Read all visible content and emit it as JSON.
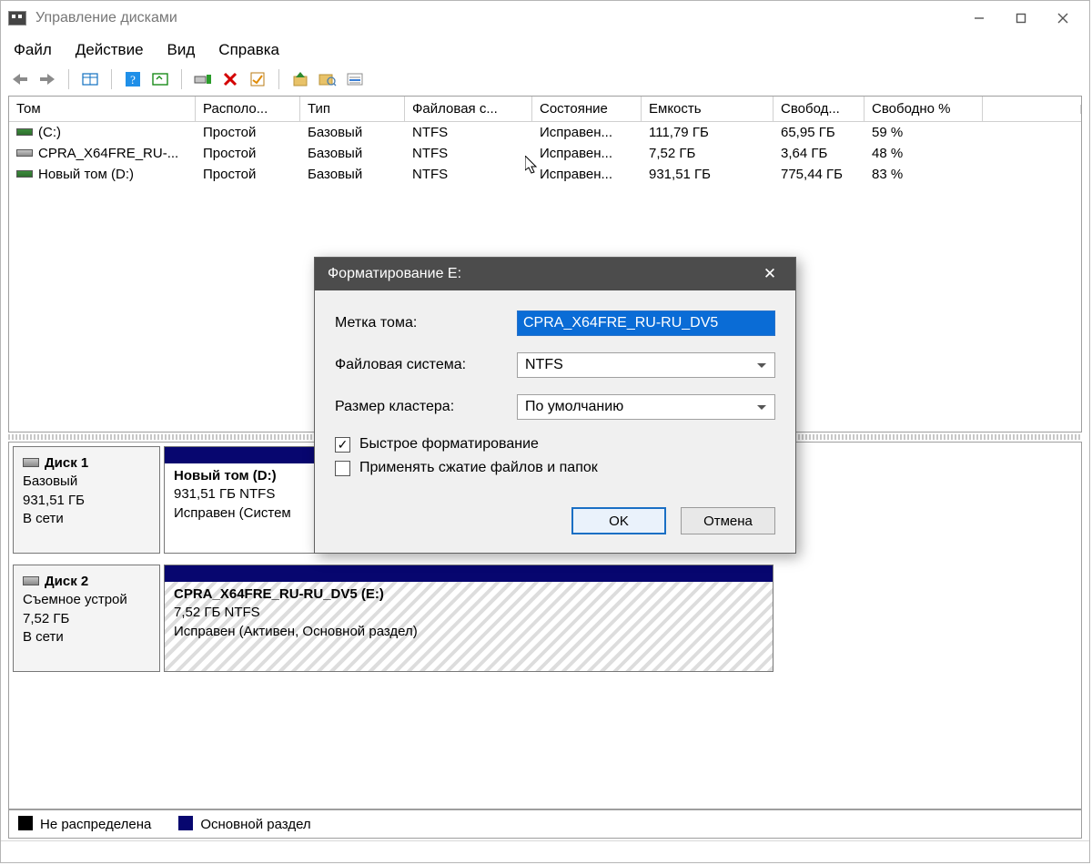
{
  "window": {
    "title": "Управление дисками",
    "menu": [
      "Файл",
      "Действие",
      "Вид",
      "Справка"
    ]
  },
  "columns": [
    "Том",
    "Располо...",
    "Тип",
    "Файловая с...",
    "Состояние",
    "Емкость",
    "Свобод...",
    "Свободно %"
  ],
  "volumes": [
    {
      "icon": "g1",
      "name": "(C:)",
      "layout": "Простой",
      "type": "Базовый",
      "fs": "NTFS",
      "status": "Исправен...",
      "cap": "111,79 ГБ",
      "free": "65,95 ГБ",
      "pct": "59 %"
    },
    {
      "icon": "g2",
      "name": "CPRA_X64FRE_RU-...",
      "layout": "Простой",
      "type": "Базовый",
      "fs": "NTFS",
      "status": "Исправен...",
      "cap": "7,52 ГБ",
      "free": "3,64 ГБ",
      "pct": "48 %"
    },
    {
      "icon": "g3",
      "name": "Новый том (D:)",
      "layout": "Простой",
      "type": "Базовый",
      "fs": "NTFS",
      "status": "Исправен...",
      "cap": "931,51 ГБ",
      "free": "775,44 ГБ",
      "pct": "83 %"
    }
  ],
  "disks": [
    {
      "label": {
        "name": "Диск 1",
        "kind": "Базовый",
        "size": "931,51 ГБ",
        "status": "В сети"
      },
      "part": {
        "name": "Новый том  (D:)",
        "line2": "931,51 ГБ NTFS",
        "line3": "Исправен (Систем"
      }
    },
    {
      "label": {
        "name": "Диск 2",
        "kind": "Съемное устрой",
        "size": "7,52 ГБ",
        "status": "В сети"
      },
      "part": {
        "name": "CPRA_X64FRE_RU-RU_DV5  (E:)",
        "line2": "7,52 ГБ NTFS",
        "line3": "Исправен (Активен, Основной раздел)"
      }
    }
  ],
  "legend": {
    "unalloc": "Не распределена",
    "primary": "Основной раздел"
  },
  "dialog": {
    "title": "Форматирование E:",
    "labels": {
      "vol": "Метка тома:",
      "fs": "Файловая система:",
      "cluster": "Размер кластера:"
    },
    "values": {
      "vol": "CPRA_X64FRE_RU-RU_DV5",
      "fs": "NTFS",
      "cluster": "По умолчанию"
    },
    "checks": {
      "quick": "Быстрое форматирование",
      "compress": "Применять сжатие файлов и папок"
    },
    "buttons": {
      "ok": "OK",
      "cancel": "Отмена"
    }
  }
}
